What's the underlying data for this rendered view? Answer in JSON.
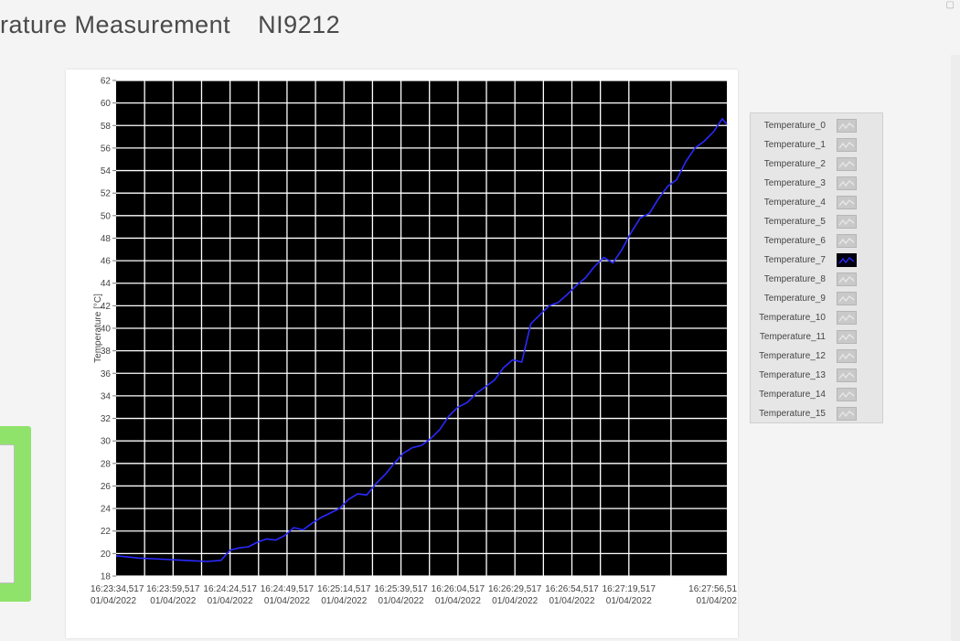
{
  "window": {
    "title_left": "rature Measurement",
    "title_right": "NI9212"
  },
  "colors": {
    "plot_background": "#000000",
    "grid": "#ffffff",
    "series_line": "#2a2aff",
    "panel": "#ffffff",
    "legend_bg": "#e6e6e6",
    "toggle": "#8fe36a"
  },
  "chart_data": {
    "type": "line",
    "ylabel": "Temperature [°C]",
    "xlabel": "",
    "ylim": [
      18,
      62
    ],
    "yticks": [
      18,
      20,
      22,
      24,
      26,
      28,
      30,
      32,
      34,
      36,
      38,
      40,
      42,
      44,
      46,
      48,
      50,
      52,
      54,
      56,
      58,
      60,
      62
    ],
    "grid": true,
    "x_tick_labels": [
      {
        "time": "16:23:34,517",
        "date": "01/04/2022"
      },
      {
        "time": "16:23:59,517",
        "date": "01/04/2022"
      },
      {
        "time": "16:24:24,517",
        "date": "01/04/2022"
      },
      {
        "time": "16:24:49,517",
        "date": "01/04/2022"
      },
      {
        "time": "16:25:14,517",
        "date": "01/04/2022"
      },
      {
        "time": "16:25:39,517",
        "date": "01/04/2022"
      },
      {
        "time": "16:26:04,517",
        "date": "01/04/2022"
      },
      {
        "time": "16:26:29,517",
        "date": "01/04/2022"
      },
      {
        "time": "16:26:54,517",
        "date": "01/04/2022"
      },
      {
        "time": "16:27:19,517",
        "date": "01/04/2022"
      },
      {
        "time": "16:27:56,51",
        "date": "01/04/202"
      }
    ],
    "x_tick_seconds": [
      0,
      25,
      50,
      75,
      100,
      125,
      150,
      175,
      200,
      225,
      262
    ],
    "xlim_seconds": [
      0,
      268
    ],
    "series": [
      {
        "name": "Temperature_7",
        "x_seconds": [
          0,
          10,
          20,
          30,
          40,
          46,
          50,
          54,
          58,
          62,
          66,
          70,
          74,
          78,
          82,
          86,
          90,
          94,
          98,
          102,
          106,
          110,
          114,
          118,
          122,
          126,
          130,
          134,
          138,
          142,
          146,
          150,
          154,
          158,
          162,
          166,
          170,
          174,
          178,
          182,
          186,
          190,
          194,
          198,
          202,
          206,
          210,
          214,
          218,
          222,
          226,
          230,
          234,
          238,
          242,
          246,
          250,
          254,
          258,
          262,
          266,
          268
        ],
        "values": [
          19.8,
          19.6,
          19.5,
          19.4,
          19.3,
          19.4,
          20.3,
          20.5,
          20.6,
          21.0,
          21.3,
          21.2,
          21.6,
          22.3,
          22.1,
          22.7,
          23.2,
          23.6,
          24.0,
          24.8,
          25.3,
          25.2,
          26.2,
          27.0,
          28.0,
          28.9,
          29.4,
          29.6,
          30.2,
          31.0,
          32.2,
          33.0,
          33.4,
          34.2,
          34.8,
          35.4,
          36.5,
          37.2,
          37.0,
          40.4,
          41.2,
          42.0,
          42.3,
          43.0,
          43.8,
          44.5,
          45.5,
          46.3,
          45.8,
          47.0,
          48.5,
          49.8,
          50.2,
          51.5,
          52.6,
          53.2,
          54.8,
          56.0,
          56.6,
          57.4,
          58.6,
          58.1
        ]
      }
    ],
    "legend": {
      "placement": "right-outside",
      "entries": [
        "Temperature_0",
        "Temperature_1",
        "Temperature_2",
        "Temperature_3",
        "Temperature_4",
        "Temperature_5",
        "Temperature_6",
        "Temperature_7",
        "Temperature_8",
        "Temperature_9",
        "Temperature_10",
        "Temperature_11",
        "Temperature_12",
        "Temperature_13",
        "Temperature_14",
        "Temperature_15"
      ],
      "active_index": 7
    }
  }
}
